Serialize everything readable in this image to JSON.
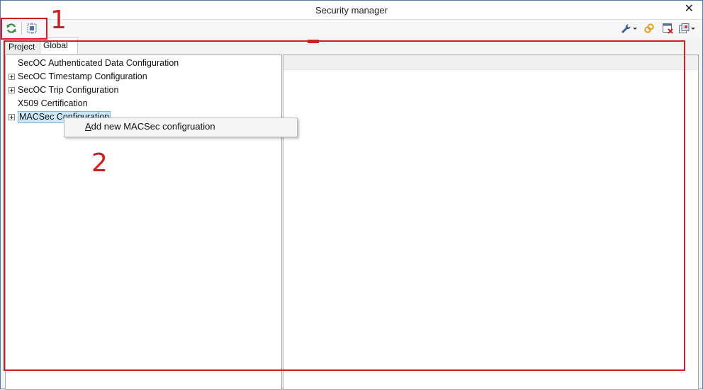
{
  "window": {
    "title": "Security manager",
    "close_glyph": "✕"
  },
  "toolbar": {
    "left_buttons": [
      {
        "icon": "refresh-icon"
      },
      {
        "icon": "select-icon"
      }
    ],
    "right_buttons": [
      {
        "icon": "wrench-dropdown-icon"
      },
      {
        "icon": "link-icon"
      },
      {
        "icon": "delete-table-icon"
      },
      {
        "icon": "export-dropdown-icon"
      }
    ]
  },
  "tabs": [
    {
      "label": "Project",
      "active": false
    },
    {
      "label": "Global",
      "active": true
    }
  ],
  "tree": {
    "items": [
      {
        "label": "SecOC Authenticated Data Configuration",
        "expandable": false
      },
      {
        "label": "SecOC Timestamp Configuration",
        "expandable": true
      },
      {
        "label": "SecOC Trip Configuration",
        "expandable": true
      },
      {
        "label": "X509 Certification",
        "expandable": false
      },
      {
        "label": "MACSec Configuration",
        "expandable": true,
        "selected": true
      }
    ]
  },
  "context_menu": {
    "item_accel": "A",
    "item_rest": "dd new MACSec configruation"
  },
  "annotations": {
    "one": "1",
    "two": "2",
    "color": "#cc2222"
  }
}
